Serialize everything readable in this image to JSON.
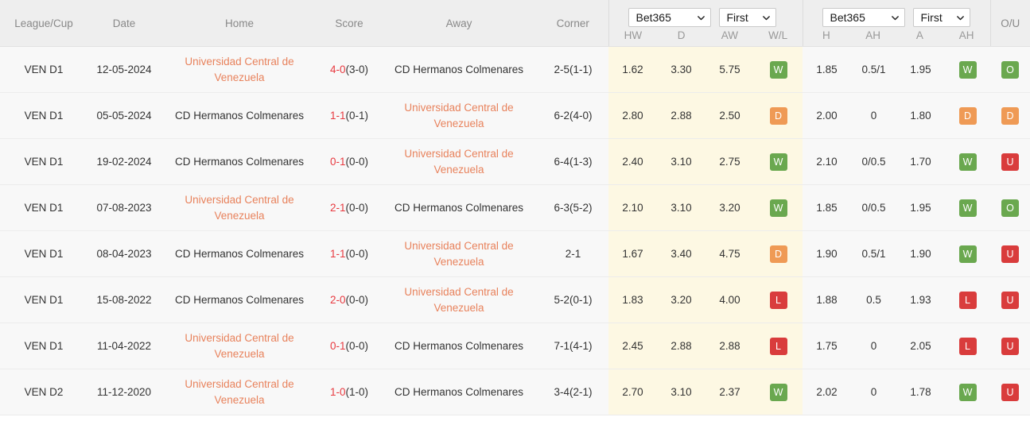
{
  "header": {
    "columns": [
      {
        "key": "league",
        "label": "League/Cup"
      },
      {
        "key": "date",
        "label": "Date"
      },
      {
        "key": "home",
        "label": "Home"
      },
      {
        "key": "score",
        "label": "Score"
      },
      {
        "key": "away",
        "label": "Away"
      },
      {
        "key": "corner",
        "label": "Corner"
      }
    ],
    "odds_group": {
      "bookmaker": "Bet365",
      "period": "First",
      "sub_columns": [
        "HW",
        "D",
        "AW",
        "W/L"
      ]
    },
    "handicap_group": {
      "bookmaker": "Bet365",
      "period": "First",
      "sub_columns": [
        "H",
        "AH",
        "A",
        "AH"
      ]
    },
    "ou_label": "O/U"
  },
  "selects": {
    "bookmaker_options": [
      "Bet365"
    ],
    "period_options": [
      "First"
    ],
    "chevron_icon": "chevron-down-icon"
  },
  "rows": [
    {
      "league": "VEN D1",
      "date": "12-05-2024",
      "home": "Universidad Central de Venezuela",
      "home_link": true,
      "score_main": "4-0",
      "score_ht": "(3-0)",
      "away": "CD Hermanos Colmenares",
      "away_link": false,
      "corner": "2-5(1-1)",
      "hw": "1.62",
      "d": "3.30",
      "aw": "5.75",
      "wl": "W",
      "h": "1.85",
      "ah1": "0.5/1",
      "a": "1.95",
      "ah2": "W",
      "ou": "O"
    },
    {
      "league": "VEN D1",
      "date": "05-05-2024",
      "home": "CD Hermanos Colmenares",
      "home_link": false,
      "score_main": "1-1",
      "score_ht": "(0-1)",
      "away": "Universidad Central de Venezuela",
      "away_link": true,
      "corner": "6-2(4-0)",
      "hw": "2.80",
      "d": "2.88",
      "aw": "2.50",
      "wl": "D",
      "h": "2.00",
      "ah1": "0",
      "a": "1.80",
      "ah2": "D",
      "ou": "D"
    },
    {
      "league": "VEN D1",
      "date": "19-02-2024",
      "home": "CD Hermanos Colmenares",
      "home_link": false,
      "score_main": "0-1",
      "score_ht": "(0-0)",
      "away": "Universidad Central de Venezuela",
      "away_link": true,
      "corner": "6-4(1-3)",
      "hw": "2.40",
      "d": "3.10",
      "aw": "2.75",
      "wl": "W",
      "h": "2.10",
      "ah1": "0/0.5",
      "a": "1.70",
      "ah2": "W",
      "ou": "U"
    },
    {
      "league": "VEN D1",
      "date": "07-08-2023",
      "home": "Universidad Central de Venezuela",
      "home_link": true,
      "score_main": "2-1",
      "score_ht": "(0-0)",
      "away": "CD Hermanos Colmenares",
      "away_link": false,
      "corner": "6-3(5-2)",
      "hw": "2.10",
      "d": "3.10",
      "aw": "3.20",
      "wl": "W",
      "h": "1.85",
      "ah1": "0/0.5",
      "a": "1.95",
      "ah2": "W",
      "ou": "O"
    },
    {
      "league": "VEN D1",
      "date": "08-04-2023",
      "home": "CD Hermanos Colmenares",
      "home_link": false,
      "score_main": "1-1",
      "score_ht": "(0-0)",
      "away": "Universidad Central de Venezuela",
      "away_link": true,
      "corner": "2-1",
      "hw": "1.67",
      "d": "3.40",
      "aw": "4.75",
      "wl": "D",
      "h": "1.90",
      "ah1": "0.5/1",
      "a": "1.90",
      "ah2": "W",
      "ou": "U"
    },
    {
      "league": "VEN D1",
      "date": "15-08-2022",
      "home": "CD Hermanos Colmenares",
      "home_link": false,
      "score_main": "2-0",
      "score_ht": "(0-0)",
      "away": "Universidad Central de Venezuela",
      "away_link": true,
      "corner": "5-2(0-1)",
      "hw": "1.83",
      "d": "3.20",
      "aw": "4.00",
      "wl": "L",
      "h": "1.88",
      "ah1": "0.5",
      "a": "1.93",
      "ah2": "L",
      "ou": "U"
    },
    {
      "league": "VEN D1",
      "date": "11-04-2022",
      "home": "Universidad Central de Venezuela",
      "home_link": true,
      "score_main": "0-1",
      "score_ht": "(0-0)",
      "away": "CD Hermanos Colmenares",
      "away_link": false,
      "corner": "7-1(4-1)",
      "hw": "2.45",
      "d": "2.88",
      "aw": "2.88",
      "wl": "L",
      "h": "1.75",
      "ah1": "0",
      "a": "2.05",
      "ah2": "L",
      "ou": "U"
    },
    {
      "league": "VEN D2",
      "date": "11-12-2020",
      "home": "Universidad Central de Venezuela",
      "home_link": true,
      "score_main": "1-0",
      "score_ht": "(1-0)",
      "away": "CD Hermanos Colmenares",
      "away_link": false,
      "corner": "3-4(2-1)",
      "hw": "2.70",
      "d": "3.10",
      "aw": "2.37",
      "wl": "W",
      "h": "2.02",
      "ah1": "0",
      "a": "1.78",
      "ah2": "W",
      "ou": "U"
    }
  ],
  "colors": {
    "team_link": "#e8825c",
    "score_main": "#e8393f",
    "win": "#6aa84f",
    "draw": "#ef9a55",
    "lose": "#d93c3c",
    "odds_bg": "#fdf8e3",
    "header_bg": "#eeeeee"
  }
}
